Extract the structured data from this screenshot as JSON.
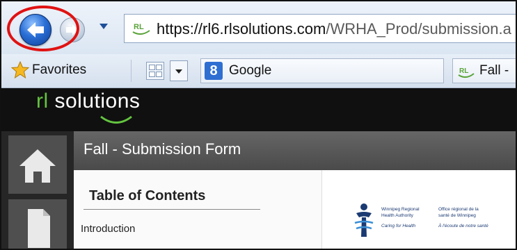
{
  "browser": {
    "address_bar": {
      "favicon_text": "RL",
      "url_scheme": "https://",
      "url_host": "rl6.rlsolutions.com",
      "url_path": "/WRHA_Prod/submission.a"
    },
    "favorites_bar": {
      "favorites_label": "Favorites",
      "tabs": [
        {
          "label": "Google",
          "icon": "google-icon"
        },
        {
          "label": "Fall -",
          "icon": "rl-favicon"
        }
      ]
    },
    "highlight_color": "#e01212"
  },
  "app": {
    "logo_prefix": "rl",
    "logo_word": " solutions",
    "form_title": "Fall - Submission Form",
    "toc": {
      "title": "Table of Contents",
      "items": [
        "Introduction"
      ]
    },
    "org_logo": {
      "english_line1": "Winnipeg Regional",
      "english_line2": "Health Authority",
      "english_tagline": "Caring for Health",
      "french_line1": "Office régional de la",
      "french_line2": "santé de Winnipeg",
      "french_tagline": "À l'écoute de notre santé"
    }
  }
}
